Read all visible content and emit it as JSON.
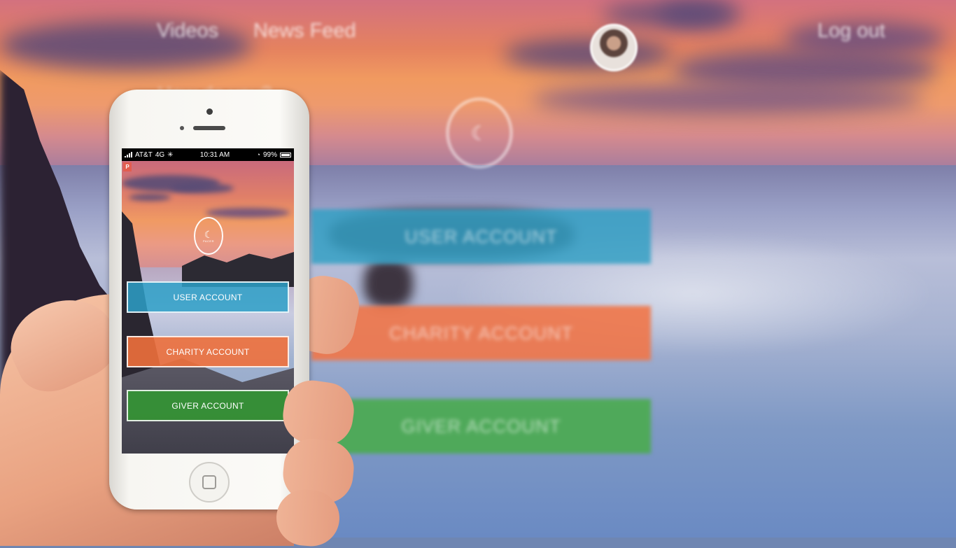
{
  "background": {
    "nav": {
      "videos": "Videos",
      "news_feed": "News Feed",
      "log_out": "Log out"
    },
    "question": "How do you?",
    "avatar_icon": "profile-avatar",
    "logo_icon": "pacer-logo",
    "buttons": {
      "user": "USER ACCOUNT",
      "charity": "CHARITY ACCOUNT",
      "giver": "GIVER ACCOUNT"
    },
    "colors": {
      "user": "#34a0c4",
      "charity": "#f17648",
      "giver": "#4baa50"
    }
  },
  "phone": {
    "status_bar": {
      "carrier": "AT&T",
      "network": "4G",
      "time": "10:31 AM",
      "battery": "99%"
    },
    "app": {
      "badge": "P",
      "logo_text": "PACER",
      "buttons": {
        "user": "USER ACCOUNT",
        "charity": "CHARITY ACCOUNT",
        "giver": "GIVER ACCOUNT"
      }
    }
  }
}
